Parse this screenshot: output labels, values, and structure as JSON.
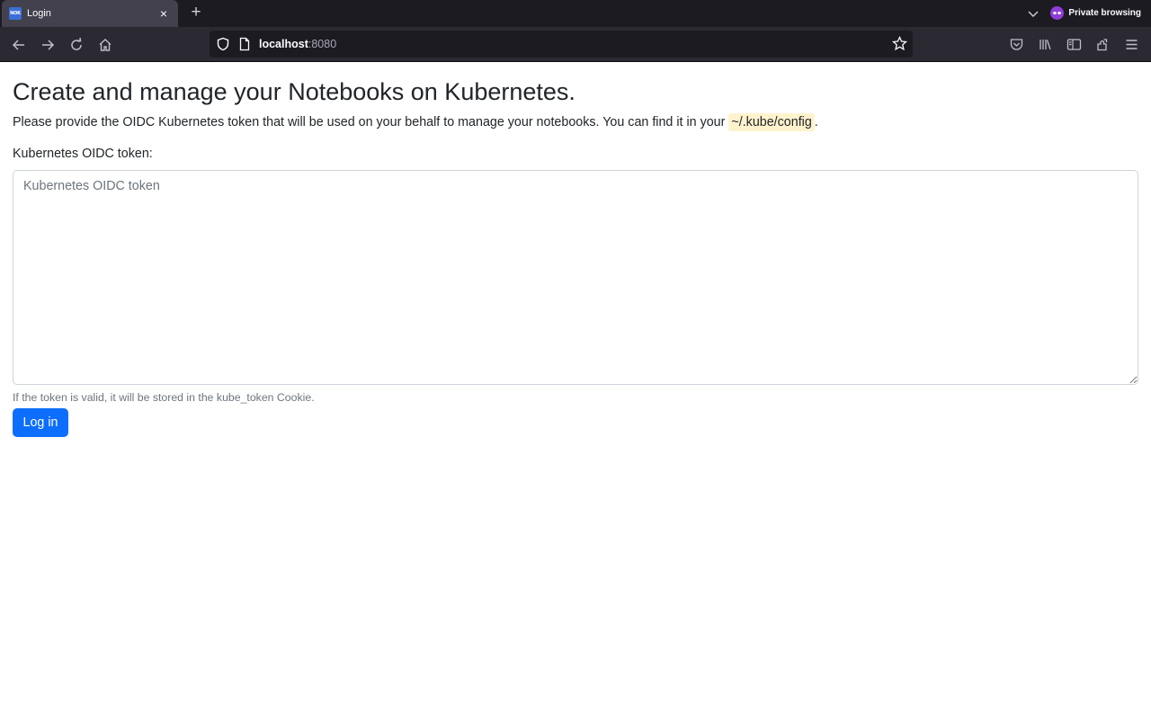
{
  "browser": {
    "tab": {
      "favicon_text": "NOK",
      "title": "Login",
      "close_glyph": "×"
    },
    "new_tab_glyph": "+",
    "private_label": "Private browsing",
    "url": {
      "host": "localhost",
      "port": ":8080"
    },
    "icons": [
      "back-icon",
      "forward-icon",
      "reload-icon",
      "home-icon",
      "shield-icon",
      "page-icon",
      "bookmark-star-icon",
      "pocket-icon",
      "library-icon",
      "sidebar-icon",
      "extensions-icon",
      "menu-icon"
    ]
  },
  "page": {
    "heading": "Create and manage your Notebooks on Kubernetes.",
    "intro_text": "Please provide the OIDC Kubernetes token that will be used on your behalf to manage your notebooks. You can find it in your ",
    "intro_code": "~/.kube/config",
    "intro_end": ".",
    "token_label": "Kubernetes OIDC token:",
    "token_placeholder": "Kubernetes OIDC token",
    "token_value": "",
    "help_text": "If the token is valid, it will be stored in the kube_token Cookie.",
    "login_button": "Log in"
  },
  "colors": {
    "primary": "#0d6efd",
    "code_bg": "#fff3cd",
    "chrome_bg": "#1c1b22",
    "toolbar_bg": "#2b2a33"
  }
}
